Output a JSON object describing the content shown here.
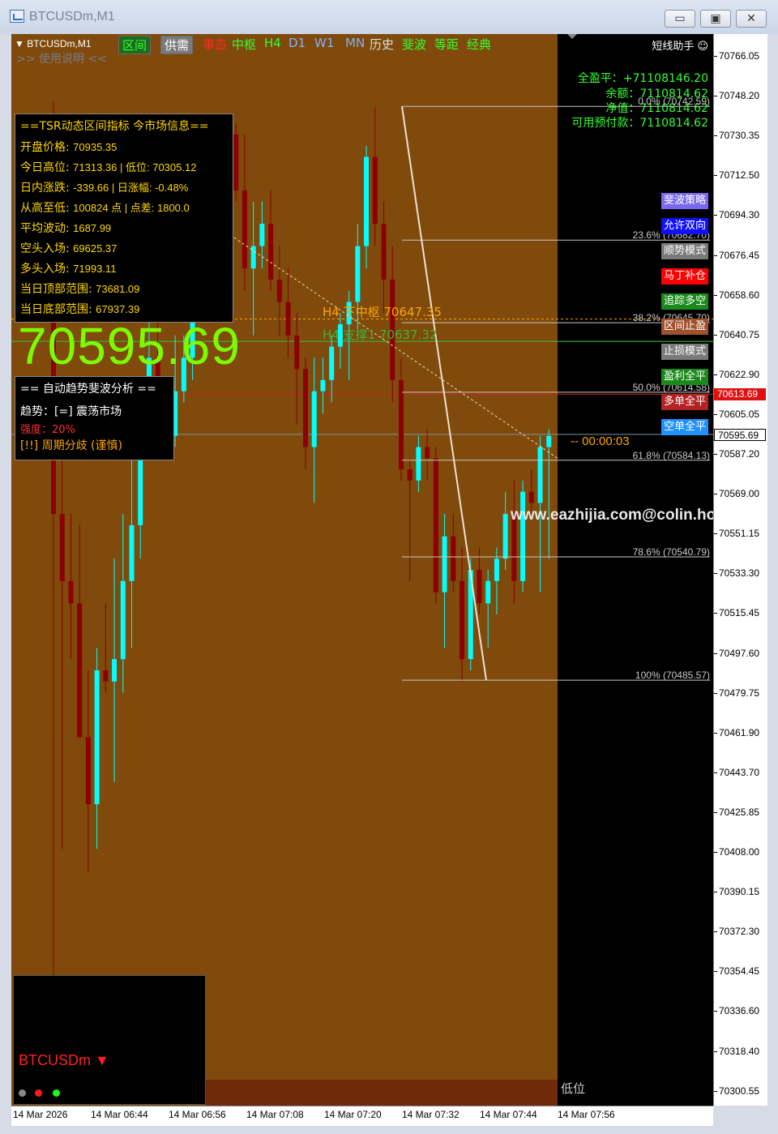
{
  "window": {
    "title": "BTCUSDm,M1",
    "minimize_label": "▭",
    "maximize_label": "▣",
    "close_label": "✕"
  },
  "toolbar": {
    "symbol": "▼ BTCUSDm,M1",
    "buttons": [
      {
        "label": "区间",
        "color": "#33ff33",
        "boxed": true,
        "bg": "#1e6b1e"
      },
      {
        "label": "供需",
        "color": "#ffffff",
        "boxed": true,
        "bg": "#7a7a7a"
      },
      {
        "label": "事态",
        "color": "#ff2a2a",
        "boxed": false
      },
      {
        "label": "中枢",
        "color": "#33ff33",
        "boxed": false
      },
      {
        "label": "H4",
        "color": "#33ff33",
        "boxed": false
      },
      {
        "label": "D1",
        "color": "#7fb2ff",
        "boxed": false
      },
      {
        "label": "W1",
        "color": "#7fb2ff",
        "boxed": false
      },
      {
        "label": "MN",
        "color": "#7fb2ff",
        "boxed": false
      },
      {
        "label": "历史",
        "color": "#dddddd",
        "boxed": false
      },
      {
        "label": "斐波",
        "color": "#33ff33",
        "boxed": false
      },
      {
        "label": "等距",
        "color": "#33ff33",
        "boxed": false
      },
      {
        "label": "经典",
        "color": "#33ff33",
        "boxed": false
      }
    ],
    "manual": ">> 使用说明 <<",
    "assistant": "短线助手 ☺"
  },
  "market_panel": {
    "title": "==TSR动态区间指标 今市场信息==",
    "rows": [
      {
        "label": "开盘价格: ",
        "value": "70935.35"
      },
      {
        "label": "今日高位: ",
        "value": "71313.36 | 低位: 70305.12"
      },
      {
        "label": "日内涨跌: ",
        "value": "-339.66 | 日涨幅: -0.48%"
      },
      {
        "label": "从高至低: ",
        "value": "100824 点 | 点差: 1800.0"
      },
      {
        "label": "平均波动: ",
        "value": "1687.99"
      },
      {
        "label": "空头入场: ",
        "value": "69625.37"
      },
      {
        "label": "多头入场: ",
        "value": "71993.11"
      },
      {
        "label": "当日顶部范围: ",
        "value": "73681.09"
      },
      {
        "label": "当日底部范围: ",
        "value": "67937.39"
      }
    ]
  },
  "big_price": "70595.69",
  "trend_panel": {
    "title": "== 自动趋势斐波分析 ==",
    "trend": "趋势：[=] 震荡市场",
    "strength": "强度：20%",
    "divergence": "[!!] 周期分歧 (谨慎)"
  },
  "account": {
    "total_pl": "全盈平：+71108146.20",
    "balance": "余额：7110814.62",
    "equity": "净值：7110814.62",
    "margin_free": "可用预付款：7110814.62"
  },
  "right_buttons": [
    {
      "label": "斐波策略",
      "bg": "#7b68ee"
    },
    {
      "label": "允许双向",
      "bg": "#1010ff"
    },
    {
      "label": "顺势模式",
      "bg": "#7a7a7a"
    },
    {
      "label": "马丁补仓",
      "bg": "#ff0000"
    },
    {
      "label": "追踪多空",
      "bg": "#1a8a1a"
    },
    {
      "label": "区间止盈",
      "bg": "#a0522d"
    },
    {
      "label": "止损模式",
      "bg": "#7a7a7a"
    },
    {
      "label": "盈利全平",
      "bg": "#1a8a1a"
    },
    {
      "label": "多单全平",
      "bg": "#b22222"
    },
    {
      "label": "空单全平",
      "bg": "#1e90ff"
    }
  ],
  "fib_levels": [
    {
      "label": "0.0% (70742.59)",
      "price": 70742.59
    },
    {
      "label": "23.6% (70682.70)",
      "price": 70682.7
    },
    {
      "label": "38.2% (70645.70)",
      "price": 70645.7
    },
    {
      "label": "50.0% (70614.58)",
      "price": 70614.58
    },
    {
      "label": "61.8% (70584.13)",
      "price": 70584.13
    },
    {
      "label": "78.6% (70540.79)",
      "price": 70540.79
    },
    {
      "label": "100% (70485.57)",
      "price": 70485.57
    }
  ],
  "h4_lines": {
    "pivot": "H4 下中枢   70647.35",
    "support": "H4 支撑1   70637.32"
  },
  "countdown": "-- 00:00:03",
  "watermark": "www.eazhijia.com@colin.hong",
  "low_label": "低位",
  "mini_panel": {
    "symbol": "BTCUSDm ▼"
  },
  "price_axis": {
    "ticks": [
      "70766.05",
      "70748.20",
      "70730.35",
      "70712.50",
      "70694.30",
      "70676.45",
      "70658.60",
      "70640.75",
      "70622.90",
      "70605.05",
      "70587.20",
      "70569.00",
      "70551.15",
      "70533.30",
      "70515.45",
      "70497.60",
      "70479.75",
      "70461.90",
      "70443.70",
      "70425.85",
      "70408.00",
      "70390.15",
      "70372.30",
      "70354.45",
      "70336.60",
      "70318.40",
      "70300.55"
    ],
    "current_bid": "70595.69",
    "red_level": "70613.69"
  },
  "time_axis": [
    "14 Mar 2026",
    "14 Mar 06:44",
    "14 Mar 06:56",
    "14 Mar 07:08",
    "14 Mar 07:20",
    "14 Mar 07:32",
    "14 Mar 07:44",
    "14 Mar 07:56"
  ],
  "chart_data": {
    "type": "candlestick",
    "symbol": "BTCUSDm",
    "timeframe": "M1",
    "ylim": [
      70295,
      70775
    ],
    "bull_color": "#00ffff",
    "bear_color": "#8b0000",
    "candles": [
      {
        "o": 70720,
        "h": 70745,
        "l": 70350,
        "c": 70560
      },
      {
        "o": 70560,
        "h": 70600,
        "l": 70410,
        "c": 70530
      },
      {
        "o": 70530,
        "h": 70560,
        "l": 70495,
        "c": 70520
      },
      {
        "o": 70520,
        "h": 70555,
        "l": 70470,
        "c": 70460
      },
      {
        "o": 70460,
        "h": 70490,
        "l": 70400,
        "c": 70430
      },
      {
        "o": 70430,
        "h": 70500,
        "l": 70410,
        "c": 70490
      },
      {
        "o": 70490,
        "h": 70520,
        "l": 70480,
        "c": 70485
      },
      {
        "o": 70485,
        "h": 70540,
        "l": 70440,
        "c": 70495
      },
      {
        "o": 70495,
        "h": 70560,
        "l": 70480,
        "c": 70530
      },
      {
        "o": 70530,
        "h": 70600,
        "l": 70500,
        "c": 70555
      },
      {
        "o": 70555,
        "h": 70620,
        "l": 70540,
        "c": 70610
      },
      {
        "o": 70610,
        "h": 70660,
        "l": 70600,
        "c": 70630
      },
      {
        "o": 70630,
        "h": 70650,
        "l": 70590,
        "c": 70600
      },
      {
        "o": 70600,
        "h": 70620,
        "l": 70590,
        "c": 70595
      },
      {
        "o": 70595,
        "h": 70640,
        "l": 70590,
        "c": 70615
      },
      {
        "o": 70615,
        "h": 70640,
        "l": 70610,
        "c": 70630
      },
      {
        "o": 70630,
        "h": 70670,
        "l": 70620,
        "c": 70660
      },
      {
        "o": 70660,
        "h": 70695,
        "l": 70650,
        "c": 70690
      },
      {
        "o": 70690,
        "h": 70705,
        "l": 70650,
        "c": 70700
      },
      {
        "o": 70700,
        "h": 70715,
        "l": 70685,
        "c": 70695
      },
      {
        "o": 70695,
        "h": 70735,
        "l": 70690,
        "c": 70730
      },
      {
        "o": 70730,
        "h": 70735,
        "l": 70700,
        "c": 70705
      },
      {
        "o": 70705,
        "h": 70730,
        "l": 70660,
        "c": 70670
      },
      {
        "o": 70670,
        "h": 70700,
        "l": 70640,
        "c": 70680
      },
      {
        "o": 70680,
        "h": 70700,
        "l": 70670,
        "c": 70690
      },
      {
        "o": 70690,
        "h": 70705,
        "l": 70660,
        "c": 70665
      },
      {
        "o": 70665,
        "h": 70680,
        "l": 70640,
        "c": 70655
      },
      {
        "o": 70655,
        "h": 70670,
        "l": 70630,
        "c": 70640
      },
      {
        "o": 70640,
        "h": 70650,
        "l": 70600,
        "c": 70625
      },
      {
        "o": 70625,
        "h": 70630,
        "l": 70580,
        "c": 70590
      },
      {
        "o": 70590,
        "h": 70630,
        "l": 70565,
        "c": 70615
      },
      {
        "o": 70615,
        "h": 70630,
        "l": 70605,
        "c": 70620
      },
      {
        "o": 70620,
        "h": 70640,
        "l": 70610,
        "c": 70635
      },
      {
        "o": 70635,
        "h": 70650,
        "l": 70625,
        "c": 70645
      },
      {
        "o": 70645,
        "h": 70660,
        "l": 70620,
        "c": 70655
      },
      {
        "o": 70655,
        "h": 70690,
        "l": 70640,
        "c": 70680
      },
      {
        "o": 70680,
        "h": 70725,
        "l": 70670,
        "c": 70720
      },
      {
        "o": 70720,
        "h": 70742,
        "l": 70680,
        "c": 70690
      },
      {
        "o": 70690,
        "h": 70700,
        "l": 70650,
        "c": 70665
      },
      {
        "o": 70665,
        "h": 70680,
        "l": 70610,
        "c": 70620
      },
      {
        "o": 70620,
        "h": 70630,
        "l": 70575,
        "c": 70580
      },
      {
        "o": 70580,
        "h": 70585,
        "l": 70530,
        "c": 70575
      },
      {
        "o": 70575,
        "h": 70595,
        "l": 70570,
        "c": 70590
      },
      {
        "o": 70590,
        "h": 70598,
        "l": 70575,
        "c": 70585
      },
      {
        "o": 70585,
        "h": 70590,
        "l": 70520,
        "c": 70525
      },
      {
        "o": 70525,
        "h": 70560,
        "l": 70500,
        "c": 70550
      },
      {
        "o": 70550,
        "h": 70560,
        "l": 70525,
        "c": 70530
      },
      {
        "o": 70530,
        "h": 70545,
        "l": 70485,
        "c": 70495
      },
      {
        "o": 70495,
        "h": 70540,
        "l": 70490,
        "c": 70535
      },
      {
        "o": 70535,
        "h": 70545,
        "l": 70515,
        "c": 70520
      },
      {
        "o": 70520,
        "h": 70535,
        "l": 70500,
        "c": 70530
      },
      {
        "o": 70530,
        "h": 70545,
        "l": 70515,
        "c": 70540
      },
      {
        "o": 70540,
        "h": 70570,
        "l": 70535,
        "c": 70560
      },
      {
        "o": 70560,
        "h": 70575,
        "l": 70520,
        "c": 70530
      },
      {
        "o": 70530,
        "h": 70575,
        "l": 70525,
        "c": 70570
      },
      {
        "o": 70570,
        "h": 70580,
        "l": 70560,
        "c": 70565
      },
      {
        "o": 70565,
        "h": 70595,
        "l": 70525,
        "c": 70590
      },
      {
        "o": 70590,
        "h": 70598,
        "l": 70540,
        "c": 70595
      }
    ]
  }
}
